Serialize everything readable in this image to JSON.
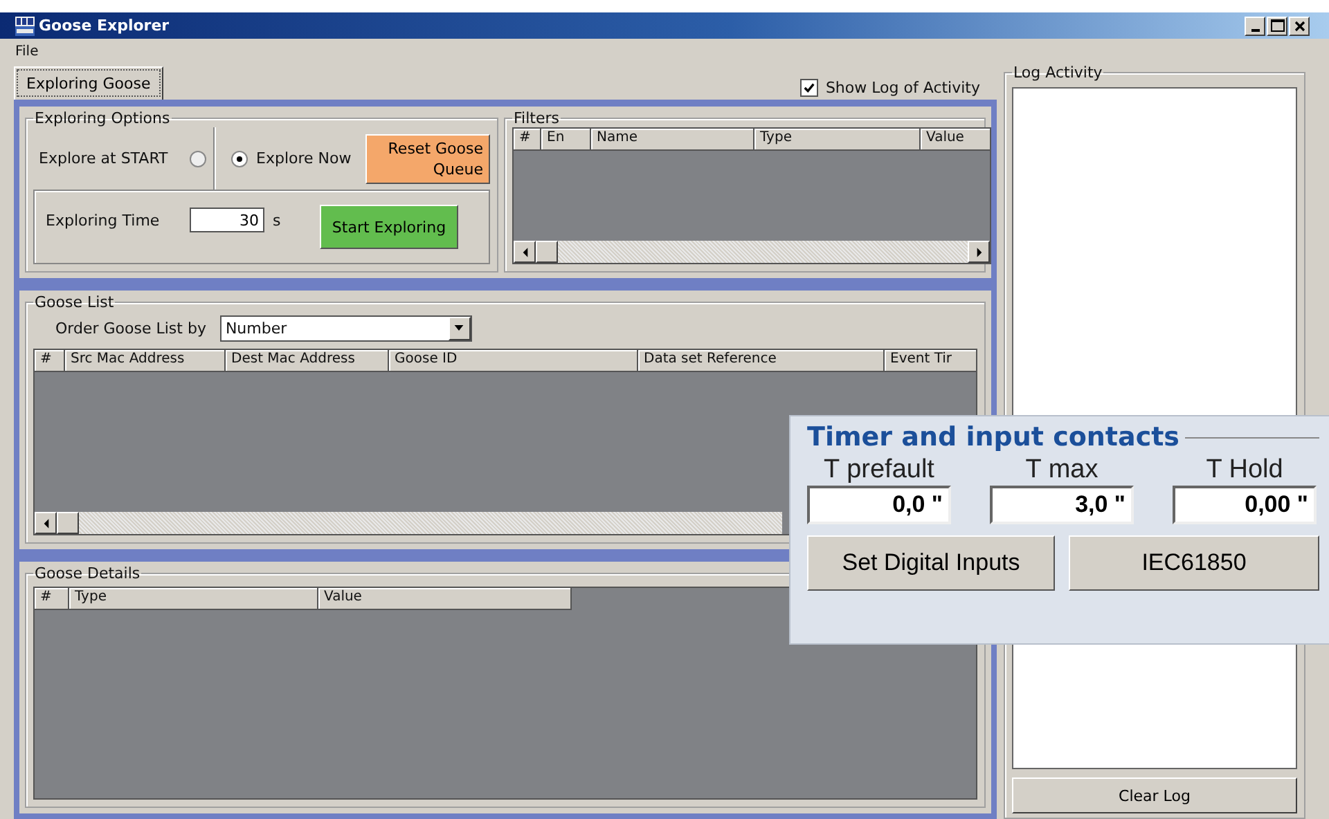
{
  "window": {
    "title": "Goose Explorer"
  },
  "menu": [
    "File"
  ],
  "tabs": [
    {
      "label": "Exploring Goose",
      "selected": true
    }
  ],
  "show_log": {
    "label": "Show Log of Activity",
    "checked": true
  },
  "exploring_options": {
    "title": "Exploring Options",
    "modes": [
      {
        "label": "Explore at START",
        "kind": "leading",
        "selected": false
      },
      {
        "label": "Explore Now",
        "kind": "trailing",
        "selected": true
      }
    ],
    "reset_button": "Reset Goose Queue",
    "time_label": "Exploring Time",
    "time_value": "30",
    "time_unit": "s",
    "start_button": "Start Exploring"
  },
  "filters": {
    "title": "Filters",
    "columns": [
      "#",
      "En",
      "Name",
      "Type",
      "Value"
    ]
  },
  "goose_list": {
    "title": "Goose List",
    "order_label": "Order Goose List by",
    "order_value": "Number",
    "columns": [
      "#",
      "Src Mac Address",
      "Dest Mac Address",
      "Goose ID",
      "Data set Reference",
      "Event Tir"
    ]
  },
  "goose_details": {
    "title": "Goose Details",
    "columns": [
      "#",
      "Type",
      "Value"
    ]
  },
  "log": {
    "title": "Log Activity",
    "clear_button": "Clear Log"
  },
  "timer_inset": {
    "title": "Timer and input contacts",
    "fields": [
      {
        "label": "T prefault",
        "value": "0,0 \""
      },
      {
        "label": "T max",
        "value": "3,0 \""
      },
      {
        "label": "T Hold",
        "value": "0,00 \""
      }
    ],
    "buttons": [
      "Set Digital Inputs",
      "IEC61850"
    ]
  }
}
